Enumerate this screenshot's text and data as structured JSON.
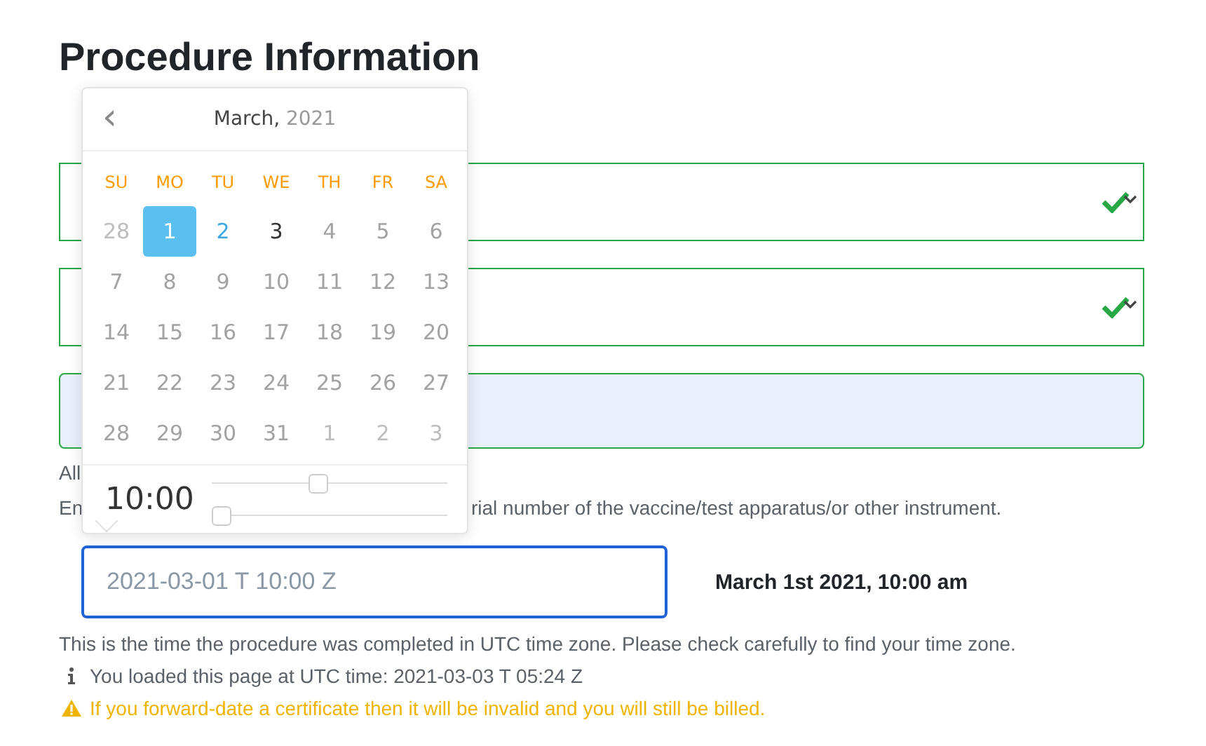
{
  "heading": "Procedure Information",
  "fields": [
    {
      "kind": "select",
      "valid": true
    },
    {
      "kind": "select",
      "valid": true
    },
    {
      "kind": "autofill",
      "valid": true
    }
  ],
  "hints": [
    {
      "parts": [
        "All"
      ]
    },
    {
      "parts": [
        "En",
        "rial number of the vaccine/test apparatus/or other instrument."
      ]
    }
  ],
  "datepicker": {
    "prev": "‹",
    "month": "March,",
    "year": "2021",
    "weekdays": [
      "SU",
      "MO",
      "TU",
      "WE",
      "TH",
      "FR",
      "SA"
    ],
    "days": [
      [
        {
          "label": "28",
          "kind": "outside",
          "selected": false
        },
        {
          "label": "1",
          "kind": "normal",
          "selected": true
        },
        {
          "label": "2",
          "kind": "hover",
          "selected": false
        },
        {
          "label": "3",
          "kind": "today",
          "selected": false
        },
        {
          "label": "4",
          "kind": "disabled",
          "selected": false
        },
        {
          "label": "5",
          "kind": "disabled",
          "selected": false
        },
        {
          "label": "6",
          "kind": "disabled",
          "selected": false
        }
      ],
      [
        {
          "label": "7",
          "kind": "disabled",
          "selected": false
        },
        {
          "label": "8",
          "kind": "disabled",
          "selected": false
        },
        {
          "label": "9",
          "kind": "disabled",
          "selected": false
        },
        {
          "label": "10",
          "kind": "disabled",
          "selected": false
        },
        {
          "label": "11",
          "kind": "disabled",
          "selected": false
        },
        {
          "label": "12",
          "kind": "disabled",
          "selected": false
        },
        {
          "label": "13",
          "kind": "disabled",
          "selected": false
        }
      ],
      [
        {
          "label": "14",
          "kind": "disabled",
          "selected": false
        },
        {
          "label": "15",
          "kind": "disabled",
          "selected": false
        },
        {
          "label": "16",
          "kind": "disabled",
          "selected": false
        },
        {
          "label": "17",
          "kind": "disabled",
          "selected": false
        },
        {
          "label": "18",
          "kind": "disabled",
          "selected": false
        },
        {
          "label": "19",
          "kind": "disabled",
          "selected": false
        },
        {
          "label": "20",
          "kind": "disabled",
          "selected": false
        }
      ],
      [
        {
          "label": "21",
          "kind": "disabled",
          "selected": false
        },
        {
          "label": "22",
          "kind": "disabled",
          "selected": false
        },
        {
          "label": "23",
          "kind": "disabled",
          "selected": false
        },
        {
          "label": "24",
          "kind": "disabled",
          "selected": false
        },
        {
          "label": "25",
          "kind": "disabled",
          "selected": false
        },
        {
          "label": "26",
          "kind": "disabled",
          "selected": false
        },
        {
          "label": "27",
          "kind": "disabled",
          "selected": false
        }
      ],
      [
        {
          "label": "28",
          "kind": "disabled",
          "selected": false
        },
        {
          "label": "29",
          "kind": "disabled",
          "selected": false
        },
        {
          "label": "30",
          "kind": "disabled",
          "selected": false
        },
        {
          "label": "31",
          "kind": "disabled",
          "selected": false
        },
        {
          "label": "1",
          "kind": "outside",
          "selected": false
        },
        {
          "label": "2",
          "kind": "outside",
          "selected": false
        },
        {
          "label": "3",
          "kind": "outside",
          "selected": false
        }
      ]
    ],
    "time": "10:00",
    "sliders": [
      {
        "level": 0.45
      },
      {
        "level": 0
      }
    ]
  },
  "date_input": {
    "placeholder": "2021-03-01 T 10:00 Z"
  },
  "date_readout": "March 1st 2021, 10:00 am",
  "help": "This is the time the procedure was completed in UTC time zone. Please check carefully to find your time zone.",
  "notes": [
    {
      "kind": "info",
      "text": "You loaded this page at UTC time: 2021-03-03 T 05:24 Z"
    },
    {
      "kind": "warning",
      "text": "If you forward-date a certificate then it will be invalid and you will still be billed."
    }
  ]
}
